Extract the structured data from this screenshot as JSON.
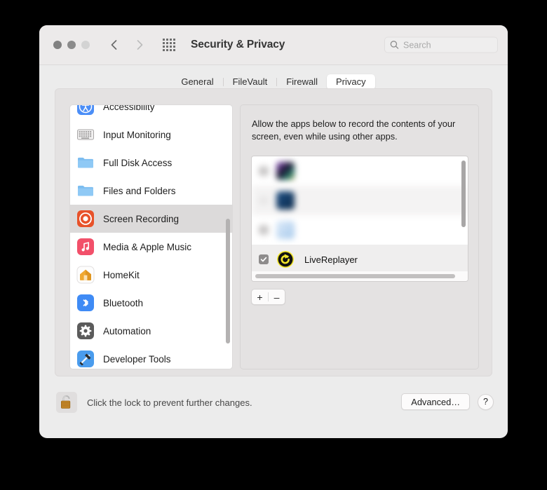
{
  "window": {
    "title": "Security & Privacy",
    "traffic_lights": [
      "close-button",
      "minimize-button",
      "zoom-button"
    ],
    "nav": {
      "back": "back-chevron-icon",
      "forward": "forward-chevron-icon",
      "grid": "show-all-grid-icon"
    }
  },
  "search": {
    "placeholder": "Search",
    "value": "",
    "icon": "search-icon"
  },
  "tabs": [
    {
      "label": "General",
      "selected": false
    },
    {
      "label": "FileVault",
      "selected": false
    },
    {
      "label": "Firewall",
      "selected": false
    },
    {
      "label": "Privacy",
      "selected": true
    }
  ],
  "sidebar": {
    "items": [
      {
        "label": "Accessibility",
        "icon": "accessibility-icon",
        "selected": false
      },
      {
        "label": "Input Monitoring",
        "icon": "keyboard-icon",
        "selected": false
      },
      {
        "label": "Full Disk Access",
        "icon": "folder-icon",
        "selected": false
      },
      {
        "label": "Files and Folders",
        "icon": "folder-icon",
        "selected": false
      },
      {
        "label": "Screen Recording",
        "icon": "screen-recording-icon",
        "selected": true
      },
      {
        "label": "Media & Apple Music",
        "icon": "music-note-icon",
        "selected": false
      },
      {
        "label": "HomeKit",
        "icon": "home-icon",
        "selected": false
      },
      {
        "label": "Bluetooth",
        "icon": "bluetooth-icon",
        "selected": false
      },
      {
        "label": "Automation",
        "icon": "gear-icon",
        "selected": false
      },
      {
        "label": "Developer Tools",
        "icon": "developer-tools-icon",
        "selected": false
      }
    ]
  },
  "detail": {
    "description": "Allow the apps below to record the contents of your screen, even while using other apps.",
    "apps": [
      {
        "label": "",
        "checked": false,
        "blurred": true,
        "icon_color": "#2a2340",
        "row_style": "plain"
      },
      {
        "label": "",
        "checked": false,
        "blurred": true,
        "icon_color": "#123a63",
        "row_style": "alt"
      },
      {
        "label": "",
        "checked": false,
        "blurred": true,
        "icon_color": "#bcd6ef",
        "row_style": "plain"
      },
      {
        "label": "LiveReplayer",
        "checked": true,
        "blurred": false,
        "icon_color": "#101010",
        "row_style": "sel"
      }
    ],
    "add_button": "+",
    "remove_button": "–"
  },
  "footer": {
    "lock_icon": "unlocked-padlock-icon",
    "lock_text": "Click the lock to prevent further changes.",
    "advanced_label": "Advanced…",
    "help_label": "?"
  }
}
